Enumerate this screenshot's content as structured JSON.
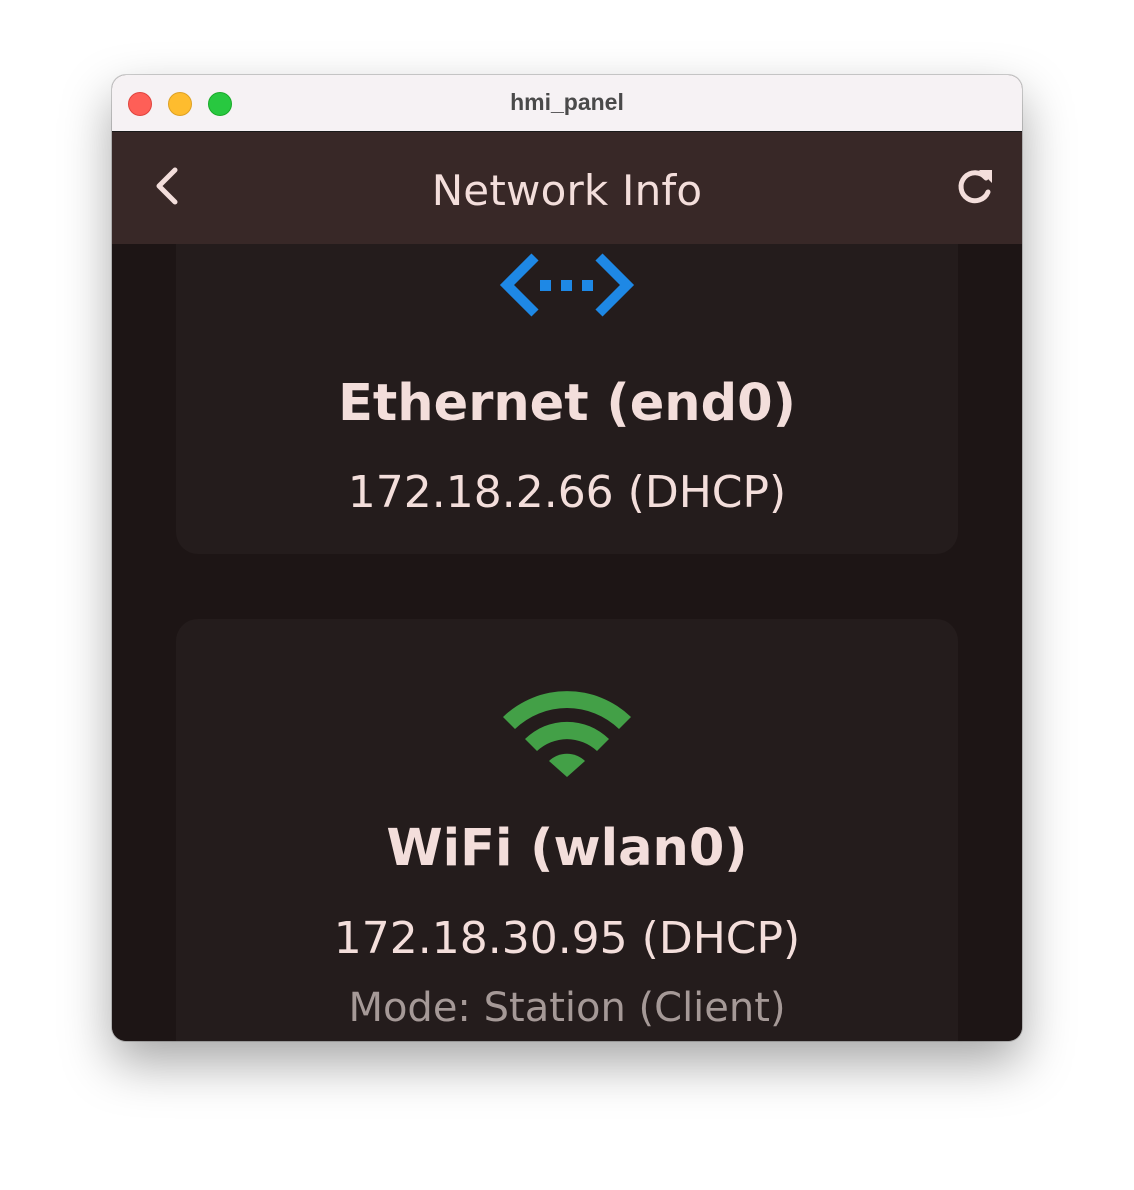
{
  "window": {
    "title": "hmi_panel"
  },
  "appbar": {
    "title": "Network Info",
    "back_icon": "chevron-left-icon",
    "refresh_icon": "refresh-icon"
  },
  "interfaces": [
    {
      "icon": "ethernet-icon",
      "icon_color": "#1e88e5",
      "title": "Ethernet (end0)",
      "ip": "172.18.2.66 (DHCP)"
    },
    {
      "icon": "wifi-icon",
      "icon_color": "#43a047",
      "title": "WiFi (wlan0)",
      "ip": "172.18.30.95 (DHCP)",
      "mode": "Mode: Station (Client)"
    }
  ],
  "colors": {
    "background": "#1d1515",
    "card": "#241c1c",
    "appbar": "#382827",
    "text": "#f3dedb",
    "muted_text": "#a59997"
  }
}
